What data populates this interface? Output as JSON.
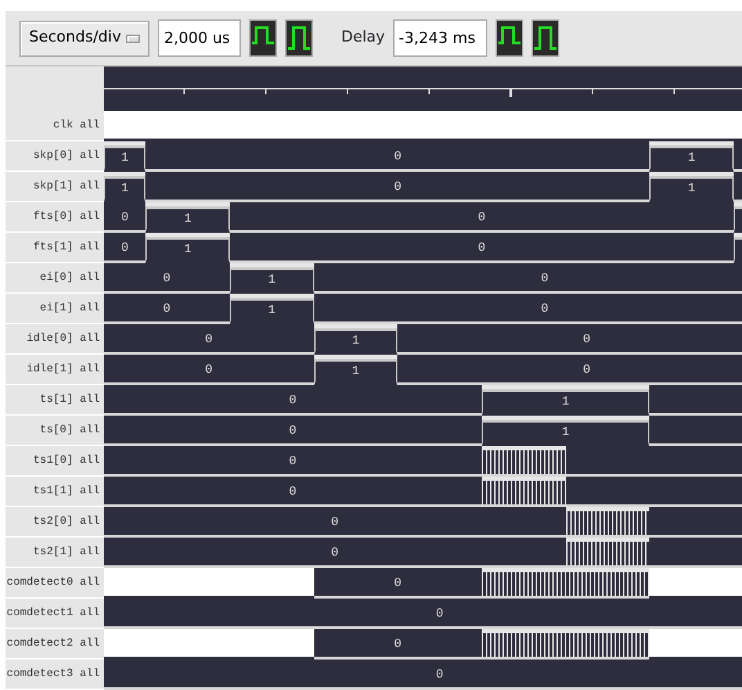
{
  "toolbar": {
    "timebase_button": "Seconds/div",
    "timebase_value": "2,000 us",
    "delay_label": "Delay",
    "delay_value": "-3,243 ms"
  },
  "signals": [
    {
      "name": "clk all",
      "steps": [
        {
          "kind": "solid"
        },
        {
          "kind": "solid"
        },
        {
          "kind": "solid"
        },
        {
          "kind": "solid"
        },
        {
          "kind": "solid"
        },
        {
          "kind": "solid"
        },
        {
          "kind": "solid"
        },
        {
          "kind": "solid"
        },
        {
          "kind": "solid"
        },
        {
          "kind": "solid"
        },
        {
          "kind": "solid"
        },
        {
          "kind": "solid"
        },
        {
          "kind": "solid"
        },
        {
          "kind": "solid"
        },
        {
          "kind": "solid"
        },
        {
          "kind": "solid"
        }
      ]
    },
    {
      "name": "skp[0] all",
      "values": [
        "1",
        "0",
        "1"
      ],
      "steps": [
        {
          "kind": "high"
        },
        {
          "kind": "low"
        },
        {
          "kind": "low"
        },
        {
          "kind": "low"
        },
        {
          "kind": "low"
        },
        {
          "kind": "low"
        },
        {
          "kind": "low"
        },
        {
          "kind": "low"
        },
        {
          "kind": "low"
        },
        {
          "kind": "low"
        },
        {
          "kind": "low"
        },
        {
          "kind": "low"
        },
        {
          "kind": "low"
        },
        {
          "kind": "high"
        },
        {
          "kind": "high"
        },
        {
          "kind": "low"
        }
      ]
    },
    {
      "name": "skp[1] all",
      "values": [
        "1",
        "0",
        "1"
      ],
      "steps": [
        {
          "kind": "high"
        },
        {
          "kind": "low"
        },
        {
          "kind": "low"
        },
        {
          "kind": "low"
        },
        {
          "kind": "low"
        },
        {
          "kind": "low"
        },
        {
          "kind": "low"
        },
        {
          "kind": "low"
        },
        {
          "kind": "low"
        },
        {
          "kind": "low"
        },
        {
          "kind": "low"
        },
        {
          "kind": "low"
        },
        {
          "kind": "low"
        },
        {
          "kind": "high"
        },
        {
          "kind": "high"
        },
        {
          "kind": "low"
        }
      ]
    },
    {
      "name": "fts[0] all",
      "values": [
        "0",
        "1",
        "0"
      ],
      "steps": [
        {
          "kind": "low"
        },
        {
          "kind": "high"
        },
        {
          "kind": "high"
        },
        {
          "kind": "low"
        },
        {
          "kind": "low"
        },
        {
          "kind": "low"
        },
        {
          "kind": "low"
        },
        {
          "kind": "low"
        },
        {
          "kind": "low"
        },
        {
          "kind": "low"
        },
        {
          "kind": "low"
        },
        {
          "kind": "low"
        },
        {
          "kind": "low"
        },
        {
          "kind": "low"
        },
        {
          "kind": "low"
        },
        {
          "kind": "high"
        }
      ]
    },
    {
      "name": "fts[1] all",
      "values": [
        "0",
        "1",
        "0"
      ],
      "steps": [
        {
          "kind": "low"
        },
        {
          "kind": "high"
        },
        {
          "kind": "high"
        },
        {
          "kind": "low"
        },
        {
          "kind": "low"
        },
        {
          "kind": "low"
        },
        {
          "kind": "low"
        },
        {
          "kind": "low"
        },
        {
          "kind": "low"
        },
        {
          "kind": "low"
        },
        {
          "kind": "low"
        },
        {
          "kind": "low"
        },
        {
          "kind": "low"
        },
        {
          "kind": "low"
        },
        {
          "kind": "low"
        },
        {
          "kind": "high"
        }
      ]
    },
    {
      "name": "ei[0] all",
      "values": [
        "0",
        "1",
        "0"
      ],
      "steps": [
        {
          "kind": "low"
        },
        {
          "kind": "low"
        },
        {
          "kind": "low"
        },
        {
          "kind": "high"
        },
        {
          "kind": "high"
        },
        {
          "kind": "low"
        },
        {
          "kind": "low"
        },
        {
          "kind": "low"
        },
        {
          "kind": "low"
        },
        {
          "kind": "low"
        },
        {
          "kind": "low"
        },
        {
          "kind": "low"
        },
        {
          "kind": "low"
        },
        {
          "kind": "low"
        },
        {
          "kind": "low"
        },
        {
          "kind": "low"
        }
      ]
    },
    {
      "name": "ei[1] all",
      "values": [
        "0",
        "1",
        "0"
      ],
      "steps": [
        {
          "kind": "low"
        },
        {
          "kind": "low"
        },
        {
          "kind": "low"
        },
        {
          "kind": "high"
        },
        {
          "kind": "high"
        },
        {
          "kind": "low"
        },
        {
          "kind": "low"
        },
        {
          "kind": "low"
        },
        {
          "kind": "low"
        },
        {
          "kind": "low"
        },
        {
          "kind": "low"
        },
        {
          "kind": "low"
        },
        {
          "kind": "low"
        },
        {
          "kind": "low"
        },
        {
          "kind": "low"
        },
        {
          "kind": "low"
        }
      ]
    },
    {
      "name": "idle[0] all",
      "values": [
        "0",
        "1",
        "0"
      ],
      "steps": [
        {
          "kind": "low"
        },
        {
          "kind": "low"
        },
        {
          "kind": "low"
        },
        {
          "kind": "low"
        },
        {
          "kind": "low"
        },
        {
          "kind": "high"
        },
        {
          "kind": "high"
        },
        {
          "kind": "low"
        },
        {
          "kind": "low"
        },
        {
          "kind": "low"
        },
        {
          "kind": "low"
        },
        {
          "kind": "low"
        },
        {
          "kind": "low"
        },
        {
          "kind": "low"
        },
        {
          "kind": "low"
        },
        {
          "kind": "low"
        }
      ]
    },
    {
      "name": "idle[1] all",
      "values": [
        "0",
        "1",
        "0"
      ],
      "steps": [
        {
          "kind": "low"
        },
        {
          "kind": "low"
        },
        {
          "kind": "low"
        },
        {
          "kind": "low"
        },
        {
          "kind": "low"
        },
        {
          "kind": "high"
        },
        {
          "kind": "high"
        },
        {
          "kind": "low"
        },
        {
          "kind": "low"
        },
        {
          "kind": "low"
        },
        {
          "kind": "low"
        },
        {
          "kind": "low"
        },
        {
          "kind": "low"
        },
        {
          "kind": "low"
        },
        {
          "kind": "low"
        },
        {
          "kind": "low"
        }
      ]
    },
    {
      "name": "ts[1] all",
      "values": [
        "0",
        "1"
      ],
      "steps": [
        {
          "kind": "low"
        },
        {
          "kind": "low"
        },
        {
          "kind": "low"
        },
        {
          "kind": "low"
        },
        {
          "kind": "low"
        },
        {
          "kind": "low"
        },
        {
          "kind": "low"
        },
        {
          "kind": "low"
        },
        {
          "kind": "low"
        },
        {
          "kind": "high"
        },
        {
          "kind": "high"
        },
        {
          "kind": "high"
        },
        {
          "kind": "high"
        },
        {
          "kind": "low"
        },
        {
          "kind": "low"
        },
        {
          "kind": "low"
        }
      ]
    },
    {
      "name": "ts[0] all",
      "values": [
        "0",
        "1"
      ],
      "steps": [
        {
          "kind": "low"
        },
        {
          "kind": "low"
        },
        {
          "kind": "low"
        },
        {
          "kind": "low"
        },
        {
          "kind": "low"
        },
        {
          "kind": "low"
        },
        {
          "kind": "low"
        },
        {
          "kind": "low"
        },
        {
          "kind": "low"
        },
        {
          "kind": "high"
        },
        {
          "kind": "high"
        },
        {
          "kind": "high"
        },
        {
          "kind": "high"
        },
        {
          "kind": "low"
        },
        {
          "kind": "low"
        },
        {
          "kind": "low"
        }
      ]
    },
    {
      "name": "ts1[0] all",
      "values": [
        "0"
      ],
      "steps": [
        {
          "kind": "low"
        },
        {
          "kind": "low"
        },
        {
          "kind": "low"
        },
        {
          "kind": "low"
        },
        {
          "kind": "low"
        },
        {
          "kind": "low"
        },
        {
          "kind": "low"
        },
        {
          "kind": "low"
        },
        {
          "kind": "low"
        },
        {
          "kind": "toggle"
        },
        {
          "kind": "toggle"
        },
        {
          "kind": "low"
        },
        {
          "kind": "low"
        },
        {
          "kind": "low"
        },
        {
          "kind": "low"
        },
        {
          "kind": "low"
        }
      ]
    },
    {
      "name": "ts1[1] all",
      "values": [
        "0"
      ],
      "steps": [
        {
          "kind": "low"
        },
        {
          "kind": "low"
        },
        {
          "kind": "low"
        },
        {
          "kind": "low"
        },
        {
          "kind": "low"
        },
        {
          "kind": "low"
        },
        {
          "kind": "low"
        },
        {
          "kind": "low"
        },
        {
          "kind": "low"
        },
        {
          "kind": "toggle"
        },
        {
          "kind": "toggle"
        },
        {
          "kind": "low"
        },
        {
          "kind": "low"
        },
        {
          "kind": "low"
        },
        {
          "kind": "low"
        },
        {
          "kind": "low"
        }
      ]
    },
    {
      "name": "ts2[0] all",
      "values": [
        "0"
      ],
      "steps": [
        {
          "kind": "low"
        },
        {
          "kind": "low"
        },
        {
          "kind": "low"
        },
        {
          "kind": "low"
        },
        {
          "kind": "low"
        },
        {
          "kind": "low"
        },
        {
          "kind": "low"
        },
        {
          "kind": "low"
        },
        {
          "kind": "low"
        },
        {
          "kind": "low"
        },
        {
          "kind": "low"
        },
        {
          "kind": "toggle"
        },
        {
          "kind": "toggle"
        },
        {
          "kind": "low"
        },
        {
          "kind": "low"
        },
        {
          "kind": "low"
        }
      ]
    },
    {
      "name": "ts2[1] all",
      "values": [
        "0"
      ],
      "steps": [
        {
          "kind": "low"
        },
        {
          "kind": "low"
        },
        {
          "kind": "low"
        },
        {
          "kind": "low"
        },
        {
          "kind": "low"
        },
        {
          "kind": "low"
        },
        {
          "kind": "low"
        },
        {
          "kind": "low"
        },
        {
          "kind": "low"
        },
        {
          "kind": "low"
        },
        {
          "kind": "low"
        },
        {
          "kind": "toggle"
        },
        {
          "kind": "toggle"
        },
        {
          "kind": "low"
        },
        {
          "kind": "low"
        },
        {
          "kind": "low"
        }
      ]
    },
    {
      "name": "comdetect0 all",
      "values": [
        "0"
      ],
      "steps": [
        {
          "kind": "solid"
        },
        {
          "kind": "solid"
        },
        {
          "kind": "solid"
        },
        {
          "kind": "solid"
        },
        {
          "kind": "solid"
        },
        {
          "kind": "low"
        },
        {
          "kind": "low"
        },
        {
          "kind": "low"
        },
        {
          "kind": "low"
        },
        {
          "kind": "toggle"
        },
        {
          "kind": "toggle"
        },
        {
          "kind": "toggle"
        },
        {
          "kind": "toggle"
        },
        {
          "kind": "solid"
        },
        {
          "kind": "solid"
        },
        {
          "kind": "solid"
        }
      ]
    },
    {
      "name": "comdetect1 all",
      "values": [
        "0"
      ],
      "steps": [
        {
          "kind": "low"
        },
        {
          "kind": "low"
        },
        {
          "kind": "low"
        },
        {
          "kind": "low"
        },
        {
          "kind": "low"
        },
        {
          "kind": "low"
        },
        {
          "kind": "low"
        },
        {
          "kind": "low"
        },
        {
          "kind": "low"
        },
        {
          "kind": "low"
        },
        {
          "kind": "low"
        },
        {
          "kind": "low"
        },
        {
          "kind": "low"
        },
        {
          "kind": "low"
        },
        {
          "kind": "low"
        },
        {
          "kind": "low"
        }
      ]
    },
    {
      "name": "comdetect2 all",
      "values": [
        "0"
      ],
      "steps": [
        {
          "kind": "solid"
        },
        {
          "kind": "solid"
        },
        {
          "kind": "solid"
        },
        {
          "kind": "solid"
        },
        {
          "kind": "solid"
        },
        {
          "kind": "low"
        },
        {
          "kind": "low"
        },
        {
          "kind": "low"
        },
        {
          "kind": "low"
        },
        {
          "kind": "toggle"
        },
        {
          "kind": "toggle"
        },
        {
          "kind": "toggle"
        },
        {
          "kind": "toggle"
        },
        {
          "kind": "solid"
        },
        {
          "kind": "solid"
        },
        {
          "kind": "solid"
        }
      ]
    },
    {
      "name": "comdetect3 all",
      "values": [
        "0"
      ],
      "steps": [
        {
          "kind": "low"
        },
        {
          "kind": "low"
        },
        {
          "kind": "low"
        },
        {
          "kind": "low"
        },
        {
          "kind": "low"
        },
        {
          "kind": "low"
        },
        {
          "kind": "low"
        },
        {
          "kind": "low"
        },
        {
          "kind": "low"
        },
        {
          "kind": "low"
        },
        {
          "kind": "low"
        },
        {
          "kind": "low"
        },
        {
          "kind": "low"
        },
        {
          "kind": "low"
        },
        {
          "kind": "low"
        },
        {
          "kind": "low"
        }
      ]
    }
  ]
}
